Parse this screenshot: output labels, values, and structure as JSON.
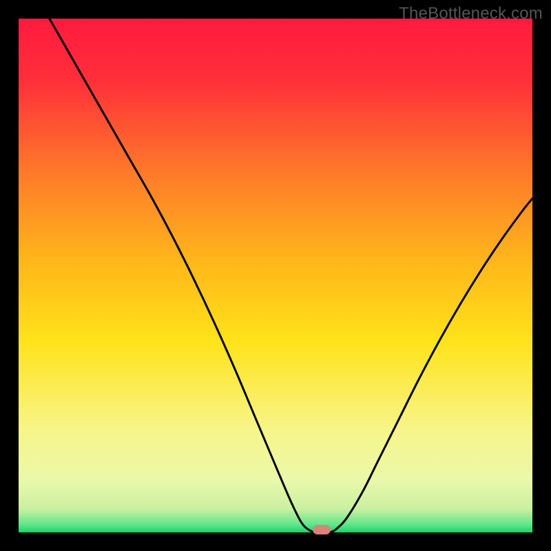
{
  "watermark": "TheBottleneck.com",
  "chart_data": {
    "type": "line",
    "title": "",
    "xlabel": "",
    "ylabel": "",
    "xlim": [
      0,
      100
    ],
    "ylim": [
      0,
      100
    ],
    "gradient_stops": [
      {
        "offset": 0.0,
        "color": "#ff1a3f"
      },
      {
        "offset": 0.12,
        "color": "#ff2f3a"
      },
      {
        "offset": 0.3,
        "color": "#ff7a2a"
      },
      {
        "offset": 0.48,
        "color": "#ffb91a"
      },
      {
        "offset": 0.63,
        "color": "#ffe31a"
      },
      {
        "offset": 0.8,
        "color": "#f7f58a"
      },
      {
        "offset": 0.9,
        "color": "#eaf8aa"
      },
      {
        "offset": 0.955,
        "color": "#c8f0a0"
      },
      {
        "offset": 0.985,
        "color": "#5fe68a"
      },
      {
        "offset": 1.0,
        "color": "#18d46a"
      }
    ],
    "series": [
      {
        "name": "bottleneck-curve",
        "points": [
          {
            "x": 6.0,
            "y": 100.0
          },
          {
            "x": 10.0,
            "y": 93.0
          },
          {
            "x": 14.0,
            "y": 86.0
          },
          {
            "x": 18.0,
            "y": 79.0
          },
          {
            "x": 22.0,
            "y": 72.0
          },
          {
            "x": 26.0,
            "y": 65.0
          },
          {
            "x": 30.0,
            "y": 57.5
          },
          {
            "x": 34.0,
            "y": 49.5
          },
          {
            "x": 38.0,
            "y": 41.0
          },
          {
            "x": 42.0,
            "y": 32.0
          },
          {
            "x": 46.0,
            "y": 22.5
          },
          {
            "x": 50.0,
            "y": 13.0
          },
          {
            "x": 53.0,
            "y": 6.0
          },
          {
            "x": 55.0,
            "y": 2.0
          },
          {
            "x": 56.5,
            "y": 0.5
          },
          {
            "x": 58.0,
            "y": 0.0
          },
          {
            "x": 60.5,
            "y": 0.0
          },
          {
            "x": 62.0,
            "y": 0.8
          },
          {
            "x": 64.0,
            "y": 3.0
          },
          {
            "x": 67.0,
            "y": 8.0
          },
          {
            "x": 70.0,
            "y": 14.0
          },
          {
            "x": 74.0,
            "y": 22.0
          },
          {
            "x": 78.0,
            "y": 30.0
          },
          {
            "x": 82.0,
            "y": 37.5
          },
          {
            "x": 86.0,
            "y": 44.5
          },
          {
            "x": 90.0,
            "y": 51.0
          },
          {
            "x": 94.0,
            "y": 57.0
          },
          {
            "x": 98.0,
            "y": 62.5
          },
          {
            "x": 100.0,
            "y": 65.0
          }
        ]
      }
    ],
    "marker": {
      "x": 59.0,
      "y": 0.6,
      "color": "#d9837a"
    }
  }
}
